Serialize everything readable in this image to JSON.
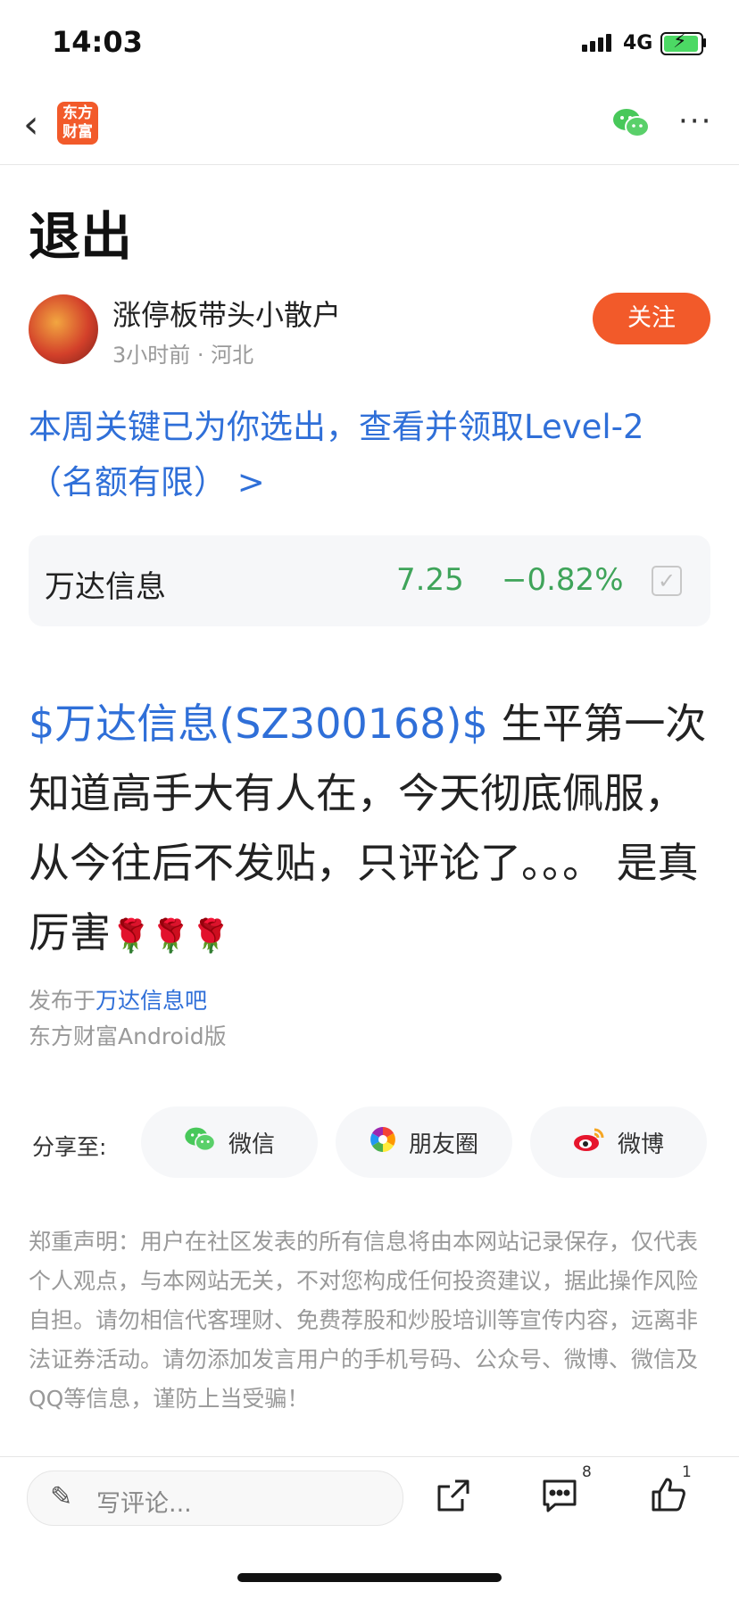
{
  "status_bar": {
    "time": "14:03",
    "network": "4G"
  },
  "nav": {
    "logo_line1": "东方",
    "logo_line2": "财富",
    "more": "···"
  },
  "post": {
    "title": "退出",
    "author": "涨停板带头小散户",
    "time": "3小时前",
    "location": "河北",
    "meta_sep": " · ",
    "follow_label": "关注",
    "promo": "本周关键已为你选出，查看并领取Level-2（名额有限） >"
  },
  "stock": {
    "name": "万达信息",
    "price": "7.25",
    "change": "−0.82%"
  },
  "body": {
    "mention": "$万达信息(SZ300168)$",
    "text": " 生平第一次知道高手大有人在，今天彻底佩服，从今往后不发贴，只评论了。。。 是真厉害",
    "emoji": "🌹🌹🌹"
  },
  "footer": {
    "posted_prefix": "发布于",
    "bar_name": "万达信息吧",
    "device": "东方财富Android版"
  },
  "share": {
    "label": "分享至:",
    "items": [
      {
        "label": "微信",
        "icon": "wechat-icon"
      },
      {
        "label": "朋友圈",
        "icon": "moments-icon"
      },
      {
        "label": "微博",
        "icon": "weibo-icon"
      }
    ]
  },
  "disclaimer": "郑重声明：用户在社区发表的所有信息将由本网站记录保存，仅代表个人观点，与本网站无关，不对您构成任何投资建议，据此操作风险自担。请勿相信代客理财、免费荐股和炒股培训等宣传内容，远离非法证券活动。请勿添加发言用户的手机号码、公众号、微博、微信及QQ等信息，谨防上当受骗！",
  "bottom": {
    "comment_placeholder": "写评论...",
    "comment_count": "8",
    "like_count": "1"
  },
  "colors": {
    "accent": "#f25a2a",
    "link": "#2f6fd8",
    "down": "#3fa45a"
  }
}
